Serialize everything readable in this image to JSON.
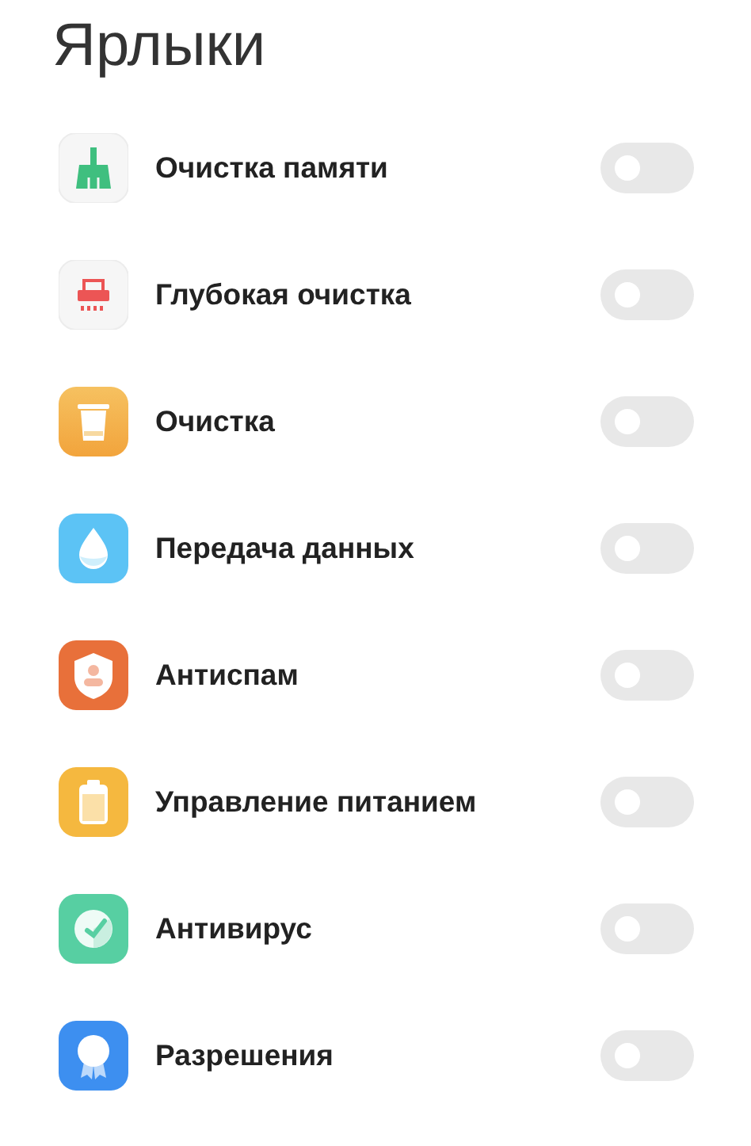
{
  "title": "Ярлыки",
  "items": [
    {
      "label": "Очистка памяти",
      "on": false
    },
    {
      "label": "Глубокая очистка",
      "on": false
    },
    {
      "label": "Очистка",
      "on": false
    },
    {
      "label": "Передача данных",
      "on": false
    },
    {
      "label": "Антиспам",
      "on": false
    },
    {
      "label": "Управление питанием",
      "on": false
    },
    {
      "label": "Антивирус",
      "on": false
    },
    {
      "label": "Разрешения",
      "on": false
    }
  ]
}
